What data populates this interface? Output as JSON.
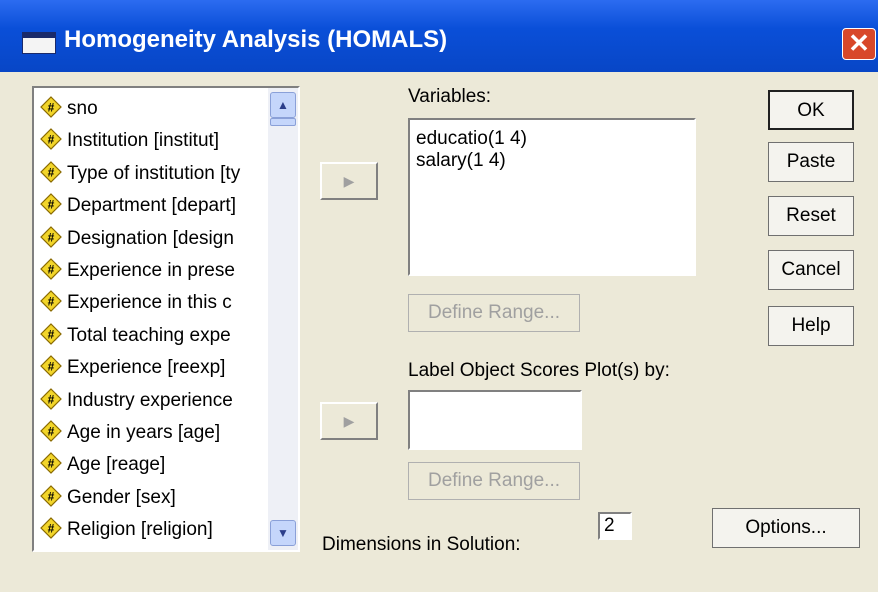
{
  "window": {
    "title": "Homogeneity Analysis (HOMALS)",
    "close_glyph": "✕"
  },
  "source_list": {
    "items": [
      "sno",
      "Institution [institut]",
      "Type of institution [ty",
      "Department [depart]",
      "Designation [design",
      "Experience in prese",
      "Experience in this c",
      "Total teaching expe",
      "Experience [reexp]",
      "Industry experience",
      "Age in years [age]",
      "Age [reage]",
      "Gender [sex]",
      "Religion [religion]"
    ],
    "item_icon": "scale-variable-icon"
  },
  "variables": {
    "label": "Variables:",
    "items": [
      "educatio(1 4)",
      "salary(1 4)"
    ],
    "define_range": "Define Range..."
  },
  "label_object": {
    "label": "Label Object Scores Plot(s) by:",
    "define_range": "Define Range..."
  },
  "dimensions": {
    "label": "Dimensions in Solution:",
    "value": "2"
  },
  "buttons": {
    "ok": "OK",
    "paste": "Paste",
    "reset": "Reset",
    "cancel": "Cancel",
    "help": "Help",
    "options": "Options..."
  },
  "colors": {
    "title_bar": "#0a4fd8",
    "dialog_bg": "#ece9d8",
    "close": "#d8482a"
  }
}
